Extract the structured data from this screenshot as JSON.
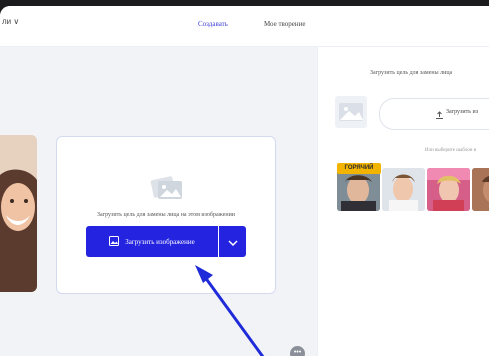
{
  "header": {
    "language_label": "ли",
    "tabs": [
      {
        "label": "Создавать",
        "active": true
      },
      {
        "label": "Мое творение",
        "active": false
      }
    ]
  },
  "main": {
    "upload_card_text": "Загрузить цель для замены лица на этом изображении",
    "upload_button_label": "Загрузить изображение",
    "help_badge": "•••"
  },
  "right_panel": {
    "title": "Загрузить цель для замены лица",
    "upload_button_label": "Загрузить из",
    "sample_text": "Или выберите шаблон в",
    "hot_badge": "ГОРЯЧИЙ"
  },
  "colors": {
    "accent": "#2424e0",
    "badge": "#f3b400",
    "arrow": "#1f2ad8"
  }
}
